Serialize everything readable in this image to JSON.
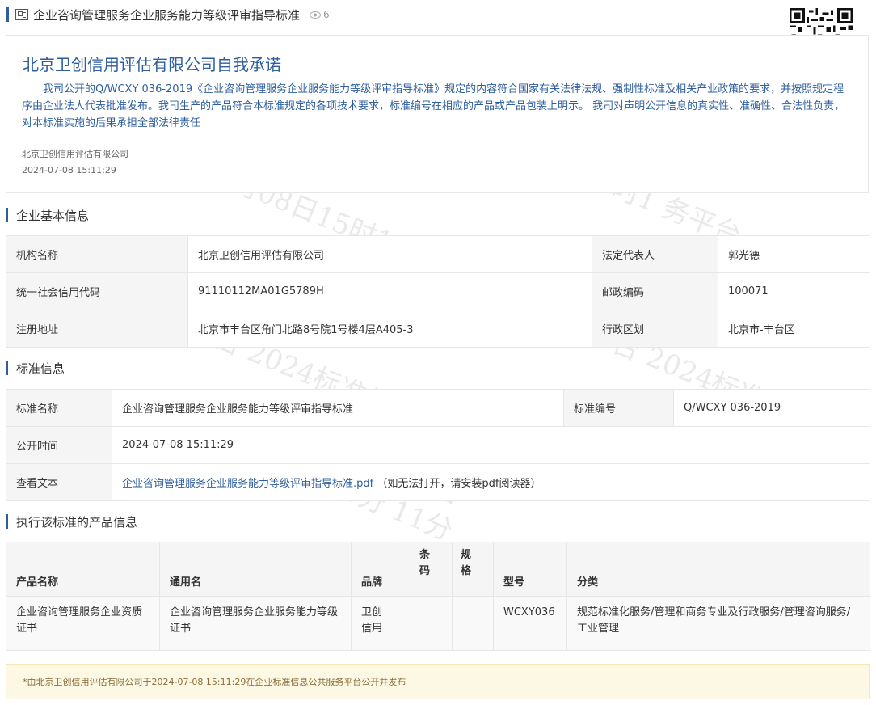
{
  "header": {
    "title": "企业咨询管理服务企业服务能力等级评审指导标准",
    "views": "6",
    "doc_icon": "document-icon",
    "eye_icon": "eye-icon",
    "qr": "qr-code"
  },
  "promise": {
    "title": "北京卫创信用评估有限公司自我承诺",
    "text": "我司公开的Q/WCXY 036-2019《企业咨询管理服务企业服务能力等级评审指导标准》规定的内容符合国家有关法律法规、强制性标准及相关产业政策的要求，并按照规定程序由企业法人代表批准发布。我司生产的产品符合本标准规定的各项技术要求，标准编号在相应的产品或产品包装上明示。 我司对声明公开信息的真实性、准确性、合法性负责，对本标准实施的后果承担全部法律责任",
    "company": "北京卫创信用评估有限公司",
    "time": "2024-07-08 15:11:29"
  },
  "basic": {
    "heading": "企业基本信息",
    "org_label": "机构名称",
    "org_value": "北京卫创信用评估有限公司",
    "legal_label": "法定代表人",
    "legal_value": "郭光德",
    "credit_label": "统一社会信用代码",
    "credit_value": "91110112MA01G5789H",
    "postal_label": "邮政编码",
    "postal_value": "100071",
    "addr_label": "注册地址",
    "addr_value": "北京市丰台区角门北路8号院1号楼4层A405-3",
    "district_label": "行政区划",
    "district_value": "北京市-丰台区"
  },
  "standard": {
    "heading": "标准信息",
    "name_label": "标准名称",
    "name_value": "企业咨询管理服务企业服务能力等级评审指导标准",
    "code_label": "标准编号",
    "code_value": "Q/WCXY 036-2019",
    "time_label": "公开时间",
    "time_value": "2024-07-08 15:11:29",
    "text_label": "查看文本",
    "text_link": "企业咨询管理服务企业服务能力等级评审指导标准.pdf",
    "text_hint": "（如无法打开，请安装pdf阅读器）"
  },
  "products": {
    "heading": "执行该标准的产品信息",
    "columns": [
      "产品名称",
      "通用名",
      "品牌",
      "条码",
      "规格",
      "型号",
      "分类"
    ],
    "rows": [
      [
        "企业咨询管理服务企业资质证书",
        "企业咨询管理服务企业服务能力等级证书",
        "卫创信用",
        "",
        "",
        "WCXY036",
        "规范标准化服务/管理和商务专业及行政服务/管理咨询服务/工业管理"
      ]
    ]
  },
  "footer": {
    "note": "*由北京卫创信用评估有限公司于2024-07-08 15:11:29在企业标准信息公共服务平台公开并发布"
  },
  "watermark": {
    "text": "企业标准信息公共服务平台 2024年07月08日15时11分"
  }
}
